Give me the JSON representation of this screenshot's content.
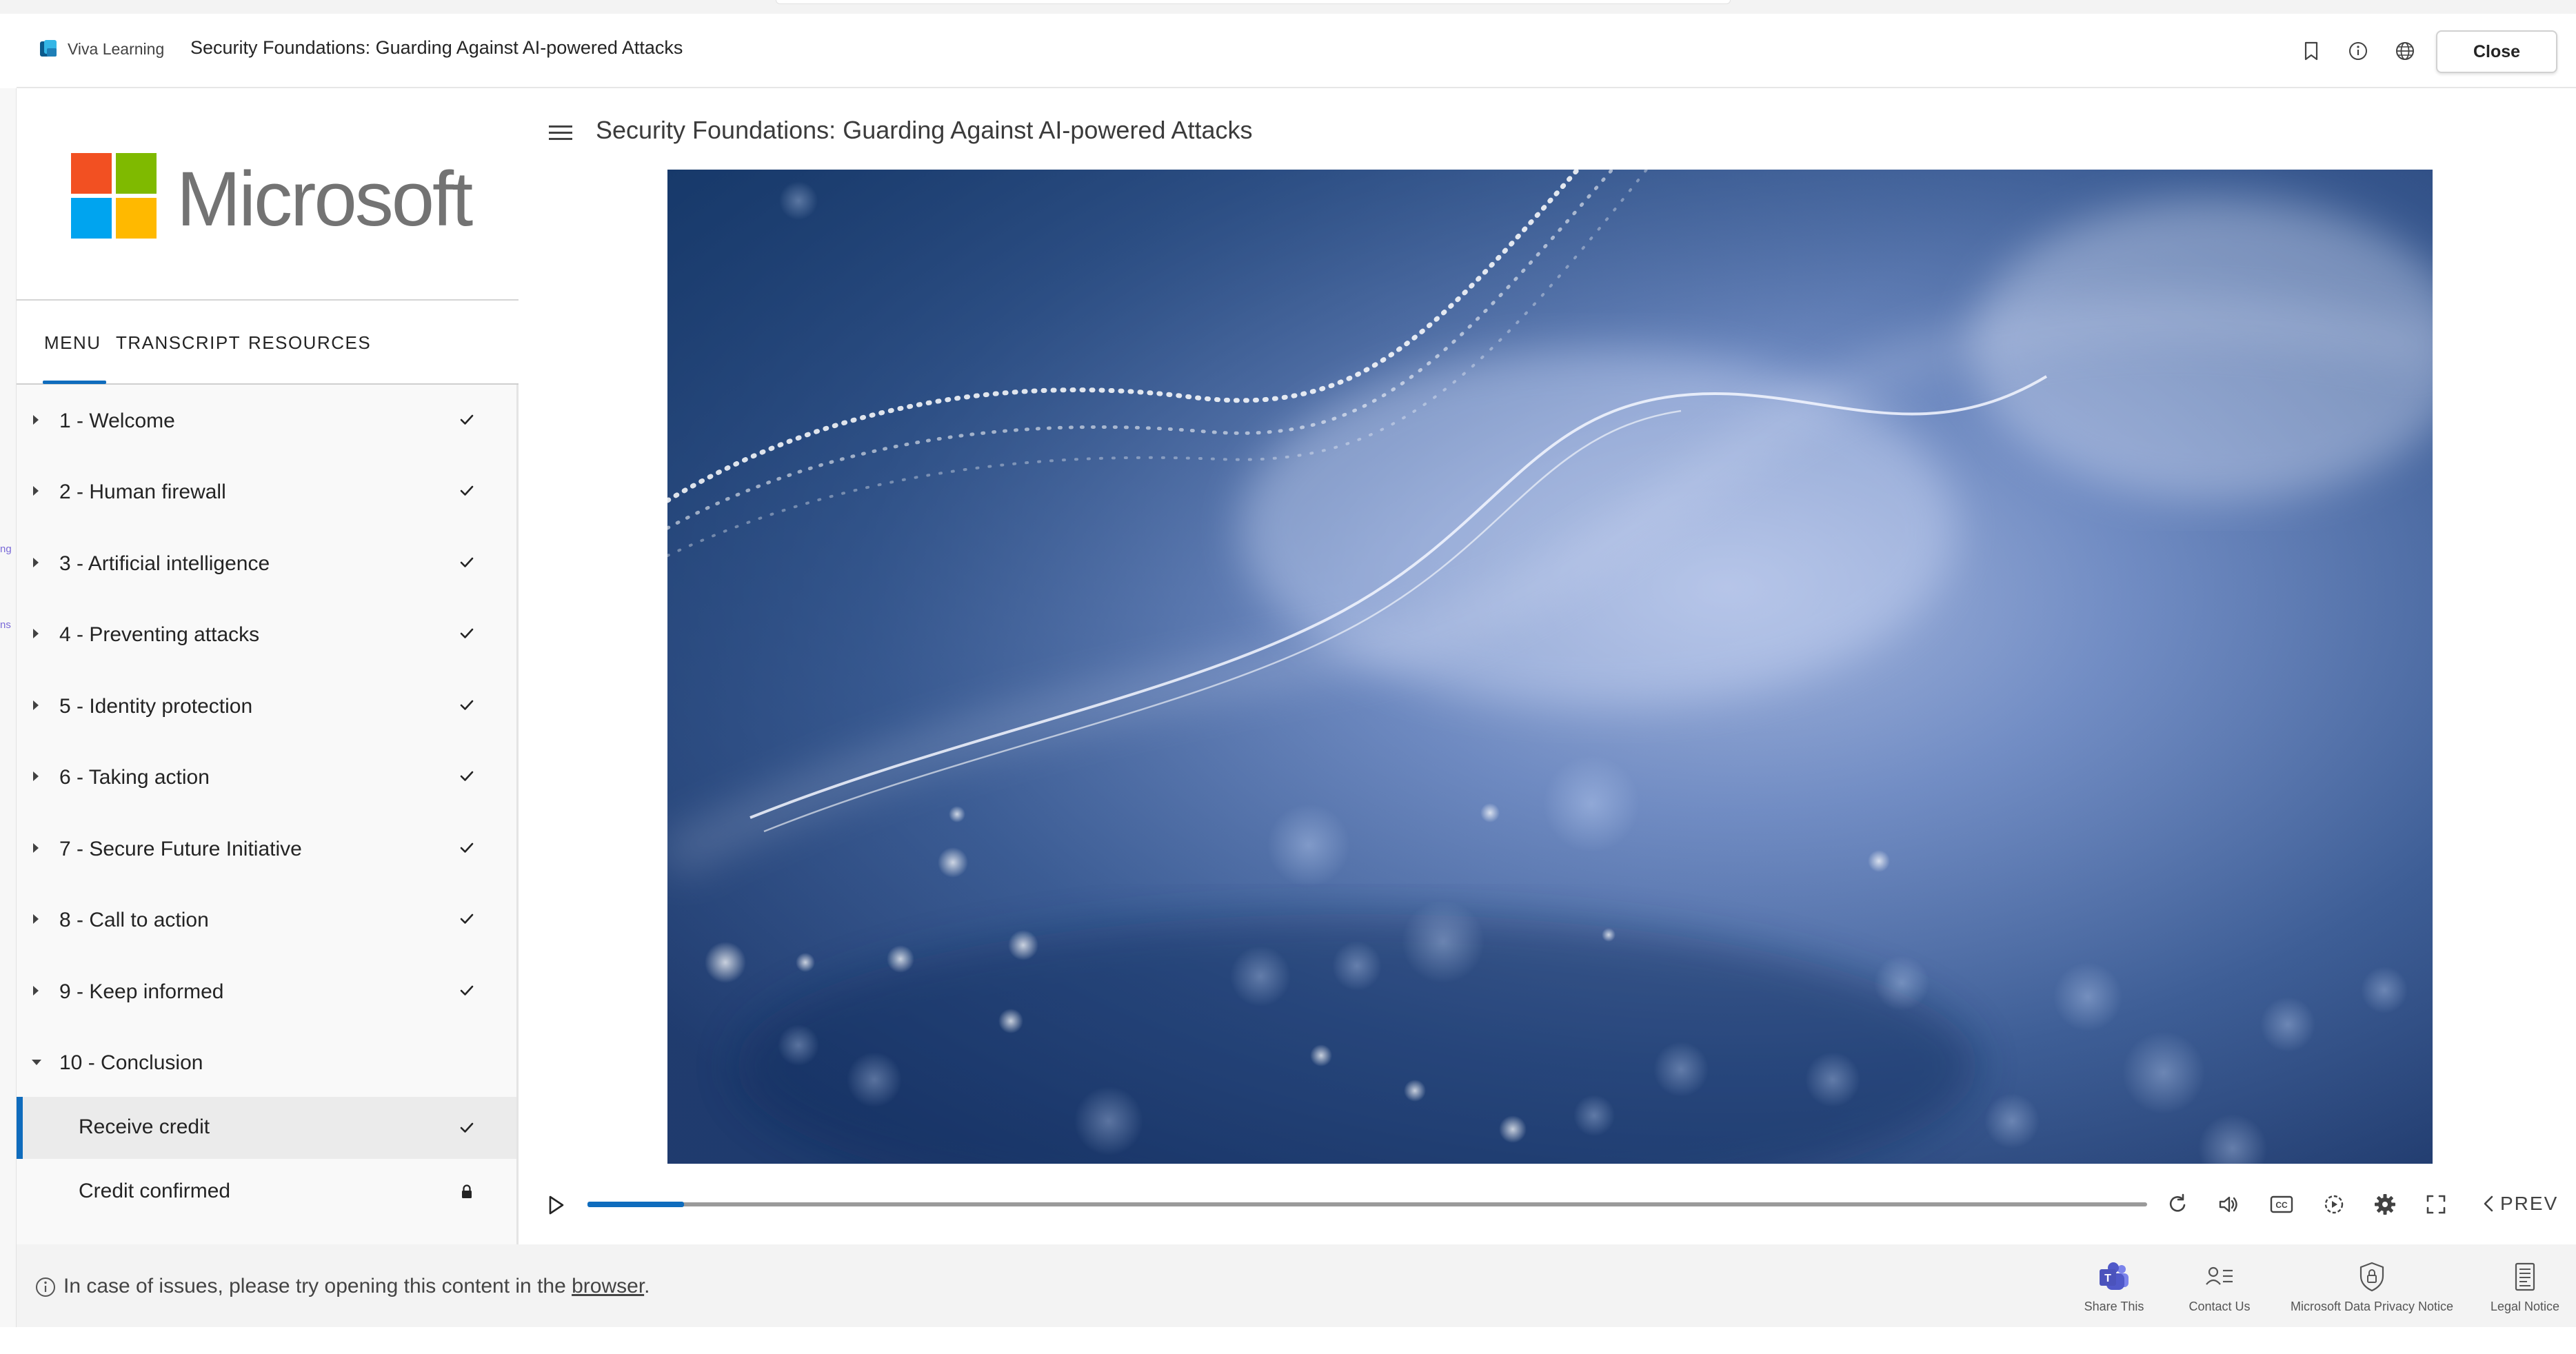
{
  "header": {
    "app_name": "Viva Learning",
    "course_title": "Security Foundations: Guarding Against AI-powered Attacks",
    "close_label": "Close",
    "icons": [
      "bookmark-icon",
      "info-icon",
      "globe-icon"
    ]
  },
  "edge": {
    "frag1": "ng",
    "frag2": "ns"
  },
  "sidebar": {
    "logo_text": "Microsoft",
    "logo_colors": [
      "#f25022",
      "#7fba00",
      "#00a4ef",
      "#ffb900"
    ],
    "tabs": [
      {
        "label": "MENU",
        "active": true
      },
      {
        "label": "TRANSCRIPT",
        "active": false
      },
      {
        "label": "RESOURCES",
        "active": false
      }
    ],
    "items": [
      {
        "label": "1 - Welcome",
        "status": "complete"
      },
      {
        "label": "2 - Human firewall",
        "status": "complete"
      },
      {
        "label": "3 - Artificial intelligence",
        "status": "complete"
      },
      {
        "label": "4 - Preventing attacks",
        "status": "complete"
      },
      {
        "label": "5 - Identity protection",
        "status": "complete"
      },
      {
        "label": "6 - Taking action",
        "status": "complete"
      },
      {
        "label": "7 - Secure Future Initiative",
        "status": "complete"
      },
      {
        "label": "8 - Call to action",
        "status": "complete"
      },
      {
        "label": "9 - Keep informed",
        "status": "complete"
      },
      {
        "label": "10 - Conclusion",
        "status": "expanded"
      }
    ],
    "subitems": [
      {
        "label": "Receive credit",
        "status": "complete",
        "active": true
      },
      {
        "label": "Credit confirmed",
        "status": "locked",
        "active": false
      }
    ]
  },
  "main": {
    "title": "Security Foundations: Guarding Against AI-powered Attacks",
    "player": {
      "progress": 0.062,
      "prev_label": "PREV",
      "control_icons": [
        "play-icon",
        "replay-icon",
        "volume-icon",
        "closed-captions-icon",
        "playback-speed-icon",
        "settings-icon",
        "fullscreen-icon"
      ]
    }
  },
  "footer": {
    "notice_prefix": "In case of issues, please try opening this content in the ",
    "notice_link": "browser",
    "notice_suffix": ".",
    "buttons": [
      {
        "label": "Share This",
        "icon": "teams-icon"
      },
      {
        "label": "Contact Us",
        "icon": "contact-icon"
      },
      {
        "label": "Microsoft Data Privacy Notice",
        "icon": "privacy-shield-icon"
      },
      {
        "label": "Legal Notice",
        "icon": "legal-document-icon"
      }
    ]
  },
  "colors": {
    "accent": "#0f6cbd",
    "video_bg": "#3d5e8e"
  }
}
